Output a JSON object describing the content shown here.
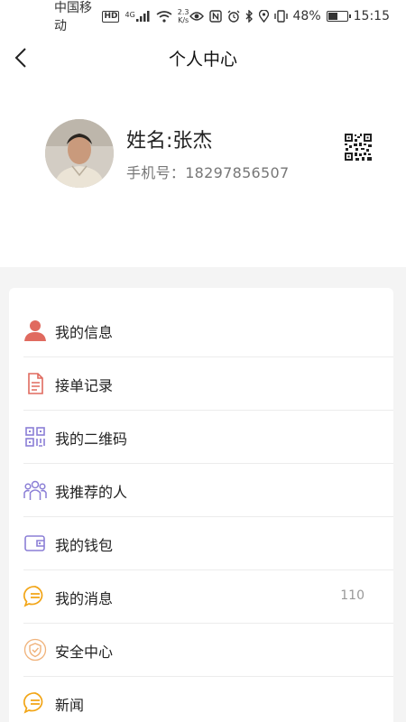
{
  "status_bar": {
    "carrier": "中国移动",
    "hd": "HD",
    "network": "4G",
    "speed_value": "2.3",
    "speed_unit": "K/s",
    "battery_percent": "48%",
    "battery_level": 0.48,
    "time": "15:15"
  },
  "nav": {
    "title": "个人中心",
    "back_icon": "chevron-left-icon"
  },
  "profile": {
    "name": "姓名:张杰",
    "phone": "手机号：18297856507",
    "qr_icon": "qr-code-icon"
  },
  "menu": {
    "items": [
      {
        "label": "我的信息",
        "icon": "person-icon",
        "color": "#e06a5f"
      },
      {
        "label": "接单记录",
        "icon": "document-icon",
        "color": "#e06a5f"
      },
      {
        "label": "我的二维码",
        "icon": "qr-code-icon",
        "color": "#8b7fd6"
      },
      {
        "label": "我推荐的人",
        "icon": "people-icon",
        "color": "#8b7fd6"
      },
      {
        "label": "我的钱包",
        "icon": "wallet-icon",
        "color": "#8b7fd6"
      },
      {
        "label": "我的消息",
        "icon": "message-icon",
        "color": "#f2a516",
        "count": "110"
      },
      {
        "label": "安全中心",
        "icon": "shield-icon",
        "color": "#f0b27a"
      },
      {
        "label": "新闻",
        "icon": "news-icon",
        "color": "#f2a516"
      }
    ]
  }
}
